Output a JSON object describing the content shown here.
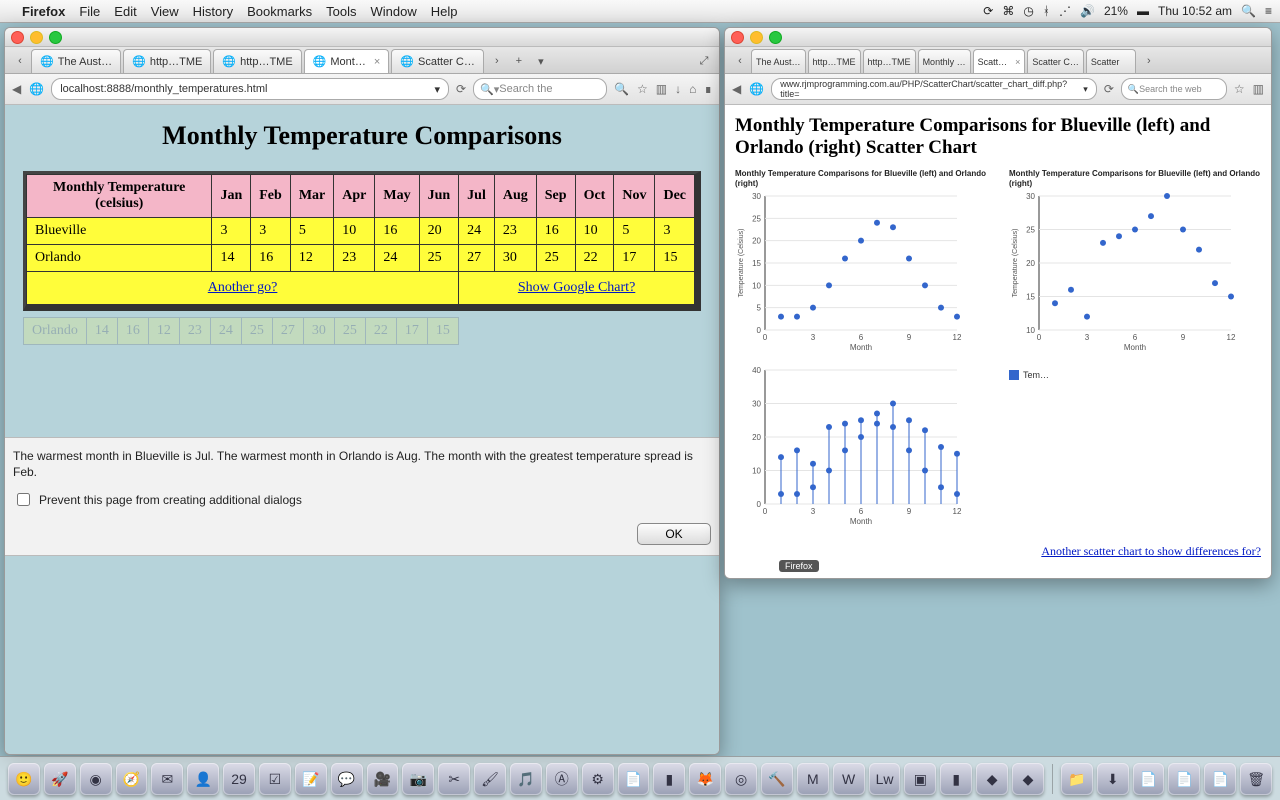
{
  "menubar": {
    "app": "Firefox",
    "items": [
      "File",
      "Edit",
      "View",
      "History",
      "Bookmarks",
      "Tools",
      "Window",
      "Help"
    ],
    "battery": "21%",
    "clock": "Thu 10:52 am"
  },
  "left_window": {
    "tabs": [
      {
        "label": "The Aust…"
      },
      {
        "label": "http…TME"
      },
      {
        "label": "http…TME"
      },
      {
        "label": "Mont…",
        "active": true
      },
      {
        "label": "Scatter C…"
      }
    ],
    "url": "localhost:8888/monthly_temperatures.html",
    "search_placeholder": "Search the",
    "page_title": "Monthly Temperature Comparisons",
    "table_header_first": "Monthly Temperature (celsius)",
    "months": [
      "Jan",
      "Feb",
      "Mar",
      "Apr",
      "May",
      "Jun",
      "Jul",
      "Aug",
      "Sep",
      "Oct",
      "Nov",
      "Dec"
    ],
    "rows": [
      {
        "name": "Blueville",
        "values": [
          3,
          3,
          5,
          10,
          16,
          20,
          24,
          23,
          16,
          10,
          5,
          3
        ]
      },
      {
        "name": "Orlando",
        "values": [
          14,
          16,
          12,
          23,
          24,
          25,
          27,
          30,
          25,
          22,
          17,
          15
        ]
      }
    ],
    "link_another": "Another go?",
    "link_chart": "Show Google Chart?",
    "dialog_text": "The warmest month in Blueville is Jul. The warmest month in Orlando is Aug. The month with the greatest temperature spread is Feb.",
    "dialog_checkbox": "Prevent this page from creating additional dialogs",
    "dialog_ok": "OK"
  },
  "right_window": {
    "tabs": [
      {
        "label": "The Aust…"
      },
      {
        "label": "http…TME"
      },
      {
        "label": "http…TME"
      },
      {
        "label": "Monthly …"
      },
      {
        "label": "Scatt…",
        "active": true
      },
      {
        "label": "Scatter C…"
      },
      {
        "label": "Scatter"
      }
    ],
    "url": "www.rjmprogramming.com.au/PHP/ScatterChart/scatter_chart_diff.php?title=",
    "search_placeholder": "Search the web",
    "page_title": "Monthly Temperature Comparisons for Blueville (left) and Orlando (right) Scatter Chart",
    "chart_caption": "Monthly Temperature Comparisons for Blueville (left) and Orlando (right)",
    "legend": "Tem…",
    "link_more": "Another scatter chart to show differences for?",
    "badge": "Firefox"
  },
  "chart_data": [
    {
      "type": "scatter",
      "title": "Monthly Temperature Comparisons for Blueville (left) and Orlando (right)",
      "xlabel": "Month",
      "ylabel": "Temperature (Celsius)",
      "xlim": [
        0,
        12
      ],
      "ylim": [
        0,
        30
      ],
      "series": [
        {
          "name": "Blueville",
          "x": [
            1,
            2,
            3,
            4,
            5,
            6,
            7,
            8,
            9,
            10,
            11,
            12
          ],
          "y": [
            3,
            3,
            5,
            10,
            16,
            20,
            24,
            23,
            16,
            10,
            5,
            3
          ]
        }
      ]
    },
    {
      "type": "scatter",
      "title": "Monthly Temperature Comparisons for Blueville (left) and Orlando (right)",
      "xlabel": "Month",
      "ylabel": "Temperature (Celsius)",
      "xlim": [
        0,
        12
      ],
      "ylim": [
        10,
        30
      ],
      "series": [
        {
          "name": "Orlando",
          "x": [
            1,
            2,
            3,
            4,
            5,
            6,
            7,
            8,
            9,
            10,
            11,
            12
          ],
          "y": [
            14,
            16,
            12,
            23,
            24,
            25,
            27,
            30,
            25,
            22,
            17,
            15
          ]
        }
      ]
    },
    {
      "type": "scatter",
      "title": "",
      "xlabel": "Month",
      "ylabel": "",
      "xlim": [
        0,
        12
      ],
      "ylim": [
        0,
        40
      ],
      "series": [
        {
          "name": "Blueville",
          "x": [
            1,
            2,
            3,
            4,
            5,
            6,
            7,
            8,
            9,
            10,
            11,
            12
          ],
          "y": [
            3,
            3,
            5,
            10,
            16,
            20,
            24,
            23,
            16,
            10,
            5,
            3
          ]
        },
        {
          "name": "Orlando",
          "x": [
            1,
            2,
            3,
            4,
            5,
            6,
            7,
            8,
            9,
            10,
            11,
            12
          ],
          "y": [
            14,
            16,
            12,
            23,
            24,
            25,
            27,
            30,
            25,
            22,
            17,
            15
          ]
        }
      ]
    }
  ]
}
